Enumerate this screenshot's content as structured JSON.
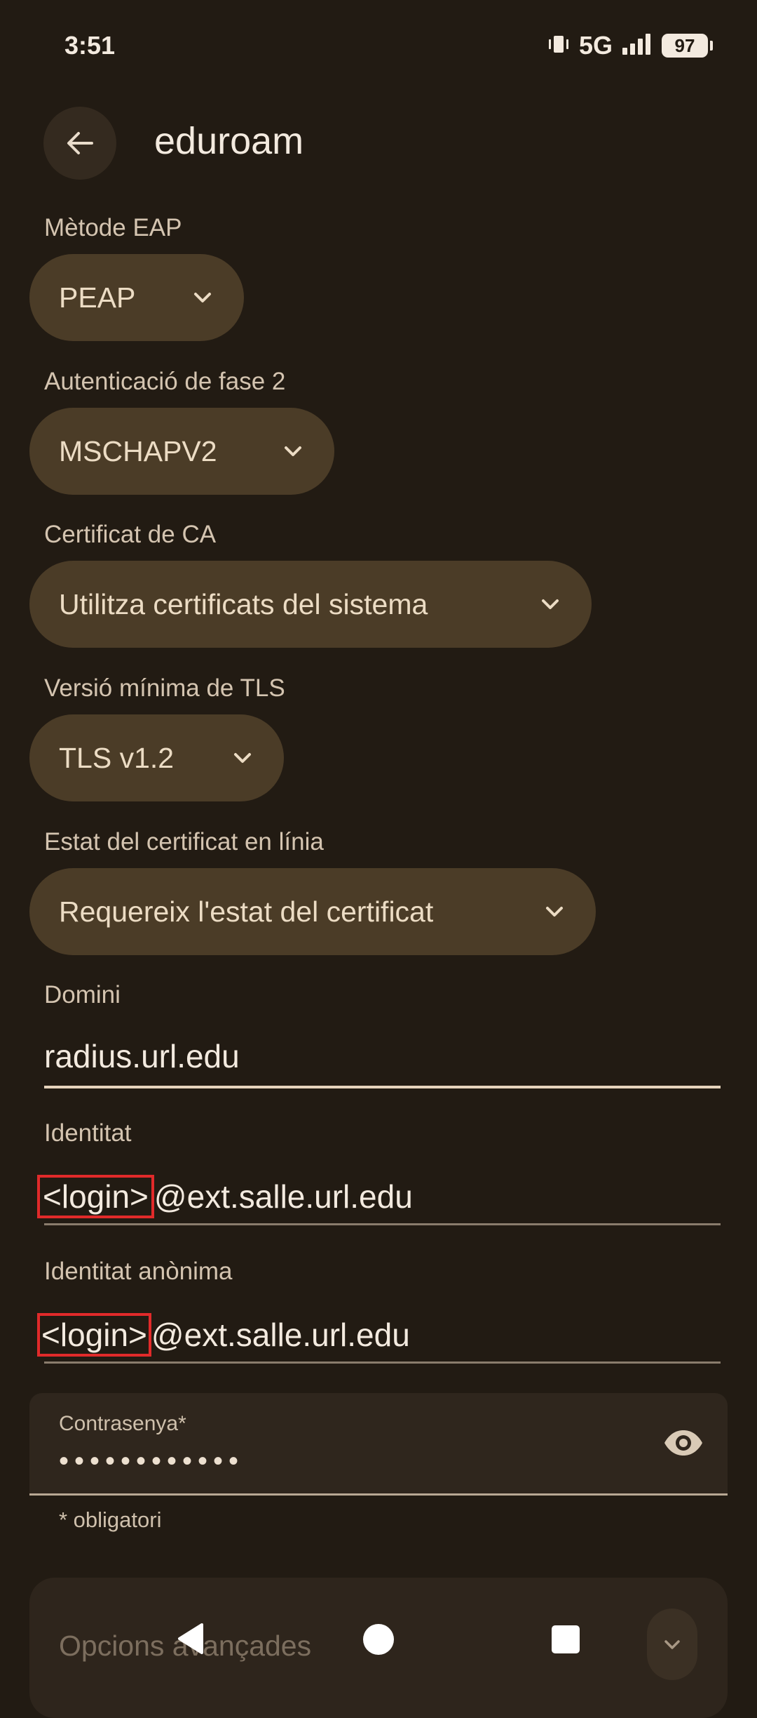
{
  "status_bar": {
    "time": "3:51",
    "network": "5G",
    "battery": "97",
    "icons": [
      "vibrate-icon",
      "signal-icon",
      "battery-icon"
    ]
  },
  "header": {
    "back_icon": "arrow-back-icon",
    "title": "eduroam"
  },
  "form": {
    "eap_method": {
      "label": "Mètode EAP",
      "value": "PEAP"
    },
    "phase2": {
      "label": "Autenticació de fase 2",
      "value": "MSCHAPV2"
    },
    "ca_cert": {
      "label": "Certificat de CA",
      "value": "Utilitza certificats del sistema"
    },
    "tls_min": {
      "label": "Versió mínima de TLS",
      "value": "TLS v1.2"
    },
    "online_status": {
      "label": "Estat del certificat en línia",
      "value": "Requereix l'estat del certificat"
    },
    "domain": {
      "label": "Domini",
      "value": "radius.url.edu"
    },
    "identity": {
      "label": "Identitat",
      "login": "<login>",
      "suffix": "@ext.salle.url.edu"
    },
    "anon_identity": {
      "label": "Identitat anònima",
      "login": "<login>",
      "suffix": "@ext.salle.url.edu"
    },
    "password": {
      "label": "Contrasenya*",
      "masked": "••••••••••••",
      "toggle_icon": "eye-icon"
    },
    "required_note": "* obligatori"
  },
  "advanced": {
    "label": "Opcions avançades"
  },
  "colors": {
    "background": "#221b13",
    "chip": "#4b3c27",
    "annotation_box": "#e12a2a"
  }
}
